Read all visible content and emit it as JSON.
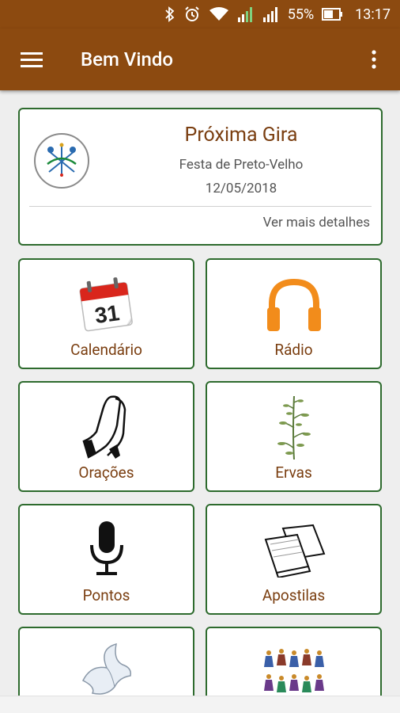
{
  "status_bar": {
    "battery": "55%",
    "time": "13:17",
    "icons": [
      "bluetooth-icon",
      "alarm-icon",
      "wifi-icon",
      "signal-1-icon",
      "signal-2-icon",
      "battery-icon"
    ]
  },
  "app_bar": {
    "title": "Bem Vindo",
    "color": "#8c4a10"
  },
  "next_gira": {
    "title": "Próxima Gira",
    "event": "Festa de Preto-Velho",
    "date": "12/05/2018",
    "more_link": "Ver mais detalhes"
  },
  "tiles": [
    {
      "label": "Calendário",
      "icon": "calendar-icon"
    },
    {
      "label": "Rádio",
      "icon": "headphones-icon"
    },
    {
      "label": "Orações",
      "icon": "praying-hands-icon"
    },
    {
      "label": "Ervas",
      "icon": "herb-icon"
    },
    {
      "label": "Pontos",
      "icon": "microphone-icon"
    },
    {
      "label": "Apostilas",
      "icon": "books-icon"
    },
    {
      "label": "",
      "icon": "dove-icon"
    },
    {
      "label": "",
      "icon": "figures-icon"
    }
  ],
  "calendar_day": "31",
  "colors": {
    "brand": "#8c4a10",
    "card_border": "#2e6b2e",
    "label": "#7a3e10",
    "radio_orange": "#f28c1b",
    "calendar_red": "#d9261c"
  }
}
